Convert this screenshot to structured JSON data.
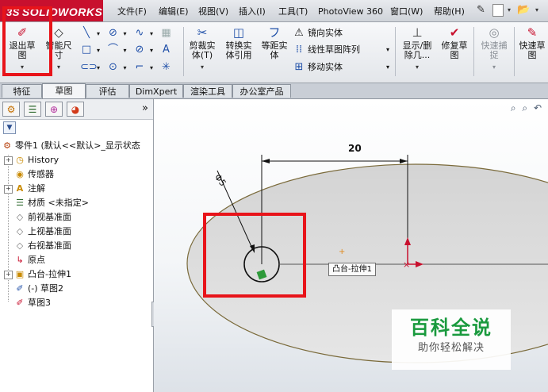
{
  "app": {
    "logo_ds": "3S",
    "logo_text": "SOLIDWORKS"
  },
  "menu": [
    {
      "label": "文件(F)"
    },
    {
      "label": "编辑(E)"
    },
    {
      "label": "视图(V)"
    },
    {
      "label": "插入(I)"
    },
    {
      "label": "工具(T)"
    },
    {
      "label": "PhotoView 360"
    },
    {
      "label": "窗口(W)"
    },
    {
      "label": "帮助(H)"
    }
  ],
  "commands": {
    "exit_sketch": "退出草\n图",
    "smart_dimension": "智能尺\n寸",
    "trim": "剪裁实\n体(T)",
    "convert": "转换实\n体引用",
    "offset": "等距实\n体",
    "mirror": "镜向实体",
    "linear_pattern": "线性草图阵列",
    "move": "移动实体",
    "display_delete": "显示/删\n除几...",
    "repair": "修复草\n图",
    "quick_snap": "快速捕\n捉",
    "rapid_sketch": "快速草\n图"
  },
  "tabs": [
    {
      "label": "特征"
    },
    {
      "label": "草图"
    },
    {
      "label": "评估"
    },
    {
      "label": "DimXpert"
    },
    {
      "label": "渲染工具"
    },
    {
      "label": "办公室产品"
    }
  ],
  "tree": {
    "root": "零件1 (默认<<默认>_显示状态",
    "items": [
      {
        "label": "History"
      },
      {
        "label": "传感器"
      },
      {
        "label": "注解"
      },
      {
        "label": "材质 <未指定>"
      },
      {
        "label": "前视基准面"
      },
      {
        "label": "上视基准面"
      },
      {
        "label": "右视基准面"
      },
      {
        "label": "原点"
      },
      {
        "label": "凸台-拉伸1"
      },
      {
        "label": "(-) 草图2"
      },
      {
        "label": "草图3"
      }
    ]
  },
  "viewport": {
    "dimension_value": "20",
    "diameter_label": "Φ5",
    "feature_callout": "凸台-拉伸1"
  },
  "watermark": {
    "title": "百科全说",
    "subtitle": "助你轻松解决"
  },
  "colors": {
    "brand_red": "#c8102e",
    "highlight_red": "#e8141a",
    "watermark_green": "#1a9a3e"
  }
}
